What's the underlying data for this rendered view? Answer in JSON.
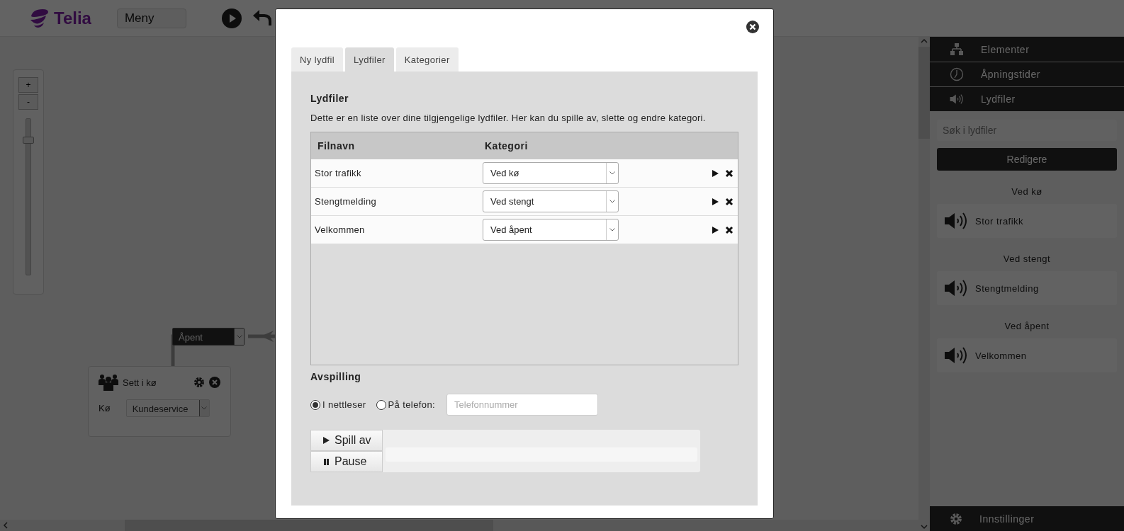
{
  "header": {
    "logo_text": "Telia",
    "menu": "Meny"
  },
  "canvas": {
    "zoom_in": "+",
    "zoom_out": "-",
    "zoom": {
      "level": 0.88
    },
    "branch": {
      "value": "Åpent"
    },
    "node": {
      "title": "Sett i kø",
      "field_label": "Kø",
      "field_value": "Kundeservice"
    }
  },
  "sidebar": {
    "sections": [
      {
        "label": "Elementer",
        "kind": "sitemap"
      },
      {
        "label": "Åpningstider",
        "kind": "clock"
      },
      {
        "label": "Lydfiler",
        "kind": "speaker"
      }
    ],
    "search": {
      "placeholder": "Søk i lydfiler"
    },
    "button": "Redigere",
    "groups": [
      {
        "heading": "Ved kø",
        "files": [
          "Stor trafikk"
        ]
      },
      {
        "heading": "Ved stengt",
        "files": [
          "Stengtmelding"
        ]
      },
      {
        "heading": "Ved åpent",
        "files": [
          "Velkommen"
        ]
      }
    ],
    "footer": "Innstillinger"
  },
  "modal": {
    "tabs": [
      {
        "label": "Ny lydfil",
        "selected": false
      },
      {
        "label": "Lydfiler",
        "selected": true
      },
      {
        "label": "Kategorier",
        "selected": false
      }
    ],
    "heading": "Lydfiler",
    "description": "Dette er en liste over dine tilgjengelige lydfiler. Her kan du spille av, slette og endre kategori.",
    "table": {
      "columns": [
        "Filnavn",
        "Kategori"
      ],
      "rows": [
        {
          "name": "Stor trafikk",
          "category": "Ved kø"
        },
        {
          "name": "Stengtmelding",
          "category": "Ved stengt"
        },
        {
          "name": "Velkommen",
          "category": "Ved åpent"
        }
      ]
    },
    "playback": {
      "heading": "Avspilling",
      "options": [
        {
          "label": "I nettleser",
          "selected": true
        },
        {
          "label": "På telefon:",
          "selected": false
        }
      ],
      "phone": {
        "placeholder": "Telefonnummer"
      },
      "play": "Spill av",
      "pause": "Pause"
    }
  }
}
